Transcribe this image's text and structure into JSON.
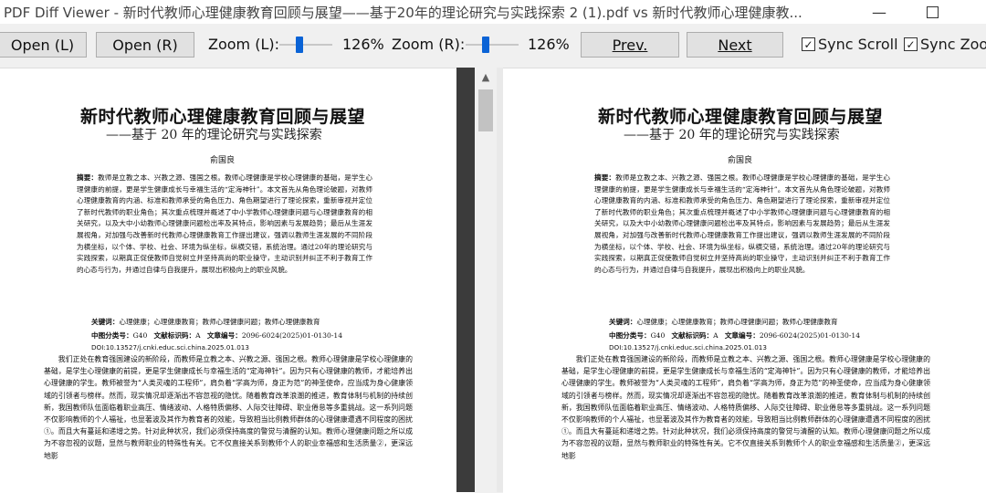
{
  "window": {
    "title": "PDF Diff Viewer - 新时代教师心理健康教育回顾与展望——基于20年的理论研究与实践探索 2 (1).pdf vs 新时代教师心理健康教...",
    "minimize_glyph": "—",
    "maximize_glyph": ""
  },
  "toolbar": {
    "open_left": "Open (L)",
    "open_right": "Open (R)",
    "zoom_left_label": "Zoom (L):",
    "zoom_left_value": "126%",
    "zoom_right_label": "Zoom (R):",
    "zoom_right_value": "126%",
    "prev": "Prev.",
    "next": "Next",
    "sync_scroll": "Sync Scroll",
    "sync_zoom": "Sync Zoo",
    "check_glyph": "✓"
  },
  "scroll": {
    "up_arrow": "▲"
  },
  "document": {
    "title": "新时代教师心理健康教育回顾与展望",
    "subtitle": "——基于 20 年的理论研究与实践探索",
    "author": "俞国良",
    "abstract_label": "摘要：",
    "abstract": "教师是立教之本、兴教之源、强国之根。教师心理健康是学校心理健康的基础，是学生心理健康的前提，更是学生健康成长与幸福生活的“定海神针”。本文首先从角色理论破题，对教师心理健康教育的内涵、标准和教师承受的角色压力、角色期望进行了理论探索，重新审视并定位了新时代教师的职业角色；其次重点梳理并概述了中小学教师心理健康问题与心理健康教育的相关研究，以及大中小幼教师心理健康问题检出率及其特点，影响因素与发展趋势；最后从生涯发展视角，对加强与改善新时代教师心理健康教育工作提出建议，强调以教师生涯发展的不同阶段为横坐标，以个体、学校、社会、环境为纵坐标，纵横交错，系统治理。通过20年的理论研究与实践探索，以期真正促使教师自觉树立并坚持高尚的职业操守，主动识别并纠正不利于教育工作的心态与行为，并通过自律与自我提升，展现出积极向上的职业风貌。",
    "keywords_label": "关键词：",
    "keywords": "心理健康；心理健康教育；教师心理健康问题；教师心理健康教育",
    "clc_label": "中图分类号：",
    "clc": "G40",
    "doc_code_label": "文献标识码：",
    "doc_code": "A",
    "article_no_label": "文章编号：",
    "article_no": "2096-6024(2025)01-0130-14",
    "doi": "DOI:10.13527/j.cnki.educ.sci.china.2025.01.013",
    "body": "我们正处在教育强国建设的新阶段，而教师是立教之本、兴教之源、强国之根。教师心理健康是学校心理健康的基础，是学生心理健康的前提，更是学生健康成长与幸福生活的“定海神针”。因为只有心理健康的教师，才能培养出心理健康的学生。教师被誉为“人类灵魂的工程师”，肩负着“学高为师，身正为范”的神圣使命，应当成为身心健康领域的引领者与榜样。然而，现实情况却逐渐出不容忽视的隐忧。随着教育改革浪潮的推进，教育体制与机制的持续创新，我国教师队伍面临着职业高压、情绪波动、人格特质偏移、人际交往障碍、职业倦怠等多重挑战。这一系列问题不仅影响教师的个人福祉，也显著波及其作为教育者的效能，导致相当比例教师群体的心理健康遭遇不同程度的困扰①。而且大有蔓延和递增之势。针对此种状况，我们必须保持高度的警觉与清醒的认知。教师心理健康问题之所以成为不容忽视的议题，显然与教师职业的特殊性有关。它不仅直接关系到教师个人的职业幸福感和生活质量②，更深远地影"
  }
}
